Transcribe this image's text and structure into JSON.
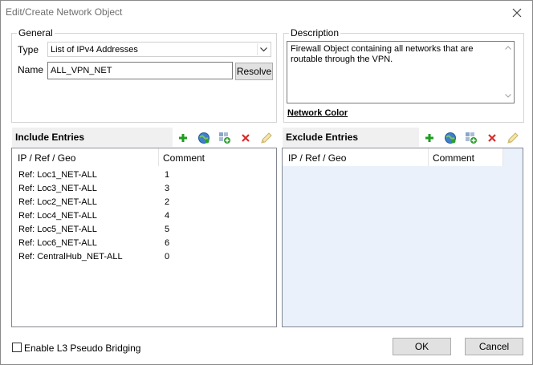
{
  "window": {
    "title": "Edit/Create Network Object"
  },
  "general": {
    "legend": "General",
    "type_label": "Type",
    "type_value": "List of IPv4 Addresses",
    "name_label": "Name",
    "name_value": "ALL_VPN_NET",
    "resolve_label": "Resolve"
  },
  "description": {
    "legend": "Description",
    "text": "Firewall Object containing all networks that are routable through the VPN.",
    "network_color_label": "Network Color"
  },
  "include": {
    "title": "Include Entries",
    "columns": [
      "IP / Ref / Geo",
      "Comment"
    ],
    "rows": [
      {
        "entry": "Ref: Loc1_NET-ALL",
        "comment": "1"
      },
      {
        "entry": "Ref: Loc3_NET-ALL",
        "comment": "3"
      },
      {
        "entry": "Ref: Loc2_NET-ALL",
        "comment": "2"
      },
      {
        "entry": "Ref: Loc4_NET-ALL",
        "comment": "4"
      },
      {
        "entry": "Ref: Loc5_NET-ALL",
        "comment": "5"
      },
      {
        "entry": "Ref: Loc6_NET-ALL",
        "comment": "6"
      },
      {
        "entry": "Ref: CentralHub_NET-ALL",
        "comment": "0"
      }
    ]
  },
  "exclude": {
    "title": "Exclude Entries",
    "columns": [
      "IP / Ref / Geo",
      "Comment"
    ]
  },
  "footer": {
    "bridging_label": "Enable L3 Pseudo Bridging",
    "bridging_checked": false,
    "ok_label": "OK",
    "cancel_label": "Cancel"
  },
  "icons": {
    "add": "plus-icon",
    "globe": "globe-icon",
    "add_object": "add-object-icon",
    "delete": "delete-x-icon",
    "edit": "pencil-icon",
    "close": "close-icon",
    "dropdown": "chevron-down-icon"
  },
  "colors": {
    "add_green": "#1f9d1f",
    "delete_red": "#d92b2b",
    "exclude_panel_bg": "#eaf1fb",
    "section_header_bg": "#f0f0f0"
  }
}
